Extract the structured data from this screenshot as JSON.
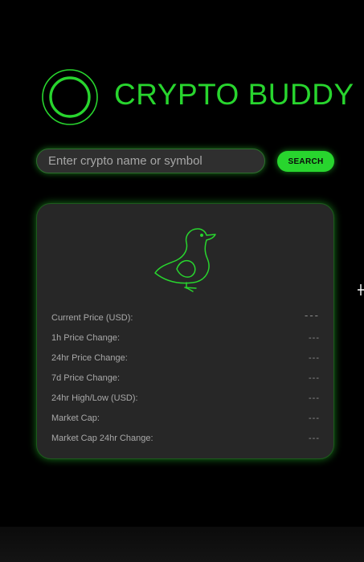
{
  "app": {
    "title": "CRYPTO BUDDY"
  },
  "search": {
    "placeholder": "Enter crypto name or symbol",
    "value": "",
    "button_label": "SEARCH"
  },
  "card": {
    "mascot_icon": "duck-icon",
    "stats": [
      {
        "label": "Current Price (USD):",
        "value": "---"
      },
      {
        "label": "1h Price Change:",
        "value": "---"
      },
      {
        "label": "24hr Price Change:",
        "value": "---"
      },
      {
        "label": "7d Price Change:",
        "value": "---"
      },
      {
        "label": "24hr High/Low (USD):",
        "value": "---"
      },
      {
        "label": "Market Cap:",
        "value": "---"
      },
      {
        "label": "Market Cap 24hr Change:",
        "value": "---"
      }
    ]
  },
  "colors": {
    "accent": "#28d52e",
    "background": "#000000",
    "card": "#272727",
    "input": "#2f2f2f"
  }
}
